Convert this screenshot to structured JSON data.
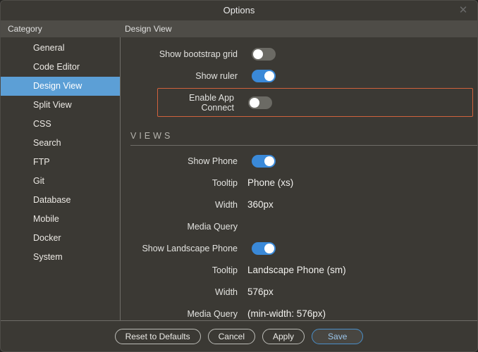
{
  "window": {
    "title": "Options"
  },
  "header": {
    "category_label": "Category",
    "page_title": "Design View"
  },
  "sidebar": {
    "items": [
      {
        "label": "General"
      },
      {
        "label": "Code Editor"
      },
      {
        "label": "Design View"
      },
      {
        "label": "Split View"
      },
      {
        "label": "CSS"
      },
      {
        "label": "Search"
      },
      {
        "label": "FTP"
      },
      {
        "label": "Git"
      },
      {
        "label": "Database"
      },
      {
        "label": "Mobile"
      },
      {
        "label": "Docker"
      },
      {
        "label": "System"
      }
    ],
    "selected_index": 2
  },
  "settings": {
    "show_bootstrap_grid": {
      "label": "Show bootstrap grid",
      "on": false
    },
    "show_ruler": {
      "label": "Show ruler",
      "on": true
    },
    "enable_app_connect": {
      "label": "Enable App Connect",
      "on": false
    },
    "views_section_title": "VIEWS",
    "show_phone": {
      "label": "Show Phone",
      "on": true
    },
    "phone_tooltip": {
      "label": "Tooltip",
      "value": "Phone (xs)"
    },
    "phone_width": {
      "label": "Width",
      "value": "360px"
    },
    "phone_media_query": {
      "label": "Media Query",
      "value": ""
    },
    "show_landscape_phone": {
      "label": "Show Landscape Phone",
      "on": true
    },
    "landscape_tooltip": {
      "label": "Tooltip",
      "value": "Landscape Phone (sm)"
    },
    "landscape_width": {
      "label": "Width",
      "value": "576px"
    },
    "landscape_media_query": {
      "label": "Media Query",
      "value": "(min-width: 576px)"
    }
  },
  "footer": {
    "reset": "Reset to Defaults",
    "cancel": "Cancel",
    "apply": "Apply",
    "save": "Save"
  }
}
